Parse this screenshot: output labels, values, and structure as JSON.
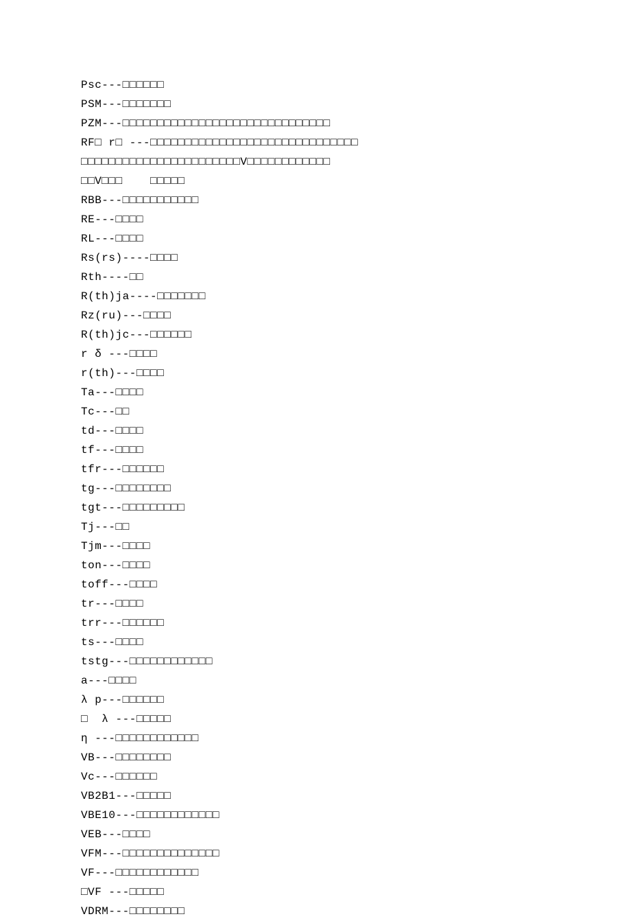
{
  "lines": [
    "Psc---□□□□□□",
    "PSM---□□□□□□□",
    "PZM---□□□□□□□□□□□□□□□□□□□□□□□□□□□□□□",
    "RF□ r□ ---□□□□□□□□□□□□□□□□□□□□□□□□□□□□□□",
    "□□□□□□□□□□□□□□□□□□□□□□□V□□□□□□□□□□□□",
    "□□V□□□    □□□□□",
    "RBB---□□□□□□□□□□□",
    "RE---□□□□",
    "RL---□□□□",
    "Rs(rs)----□□□□",
    "Rth----□□",
    "R(th)ja----□□□□□□□",
    "Rz(ru)---□□□□",
    "R(th)jc---□□□□□□",
    "r δ ---□□□□",
    "r(th)---□□□□",
    "Ta---□□□□",
    "Tc---□□",
    "td---□□□□",
    "tf---□□□□",
    "tfr---□□□□□□",
    "tg---□□□□□□□□",
    "tgt---□□□□□□□□□",
    "Tj---□□",
    "Tjm---□□□□",
    "ton---□□□□",
    "toff---□□□□",
    "tr---□□□□",
    "trr---□□□□□□",
    "ts---□□□□",
    "tstg---□□□□□□□□□□□□",
    "a---□□□□",
    "λ p---□□□□□□",
    "□  λ ---□□□□□",
    "η ---□□□□□□□□□□□□",
    "VB---□□□□□□□□",
    "Vc---□□□□□□",
    "VB2B1---□□□□□",
    "VBE10---□□□□□□□□□□□□",
    "VEB---□□□□",
    "VFM---□□□□□□□□□□□□□□",
    "VF---□□□□□□□□□□□□",
    "□VF ---□□□□□",
    "VDRM---□□□□□□□□"
  ]
}
